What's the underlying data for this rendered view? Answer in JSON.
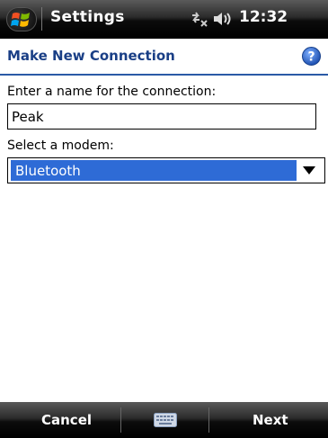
{
  "status_bar": {
    "app_title": "Settings",
    "time": "12:32",
    "icons": [
      "windows-start-icon",
      "connectivity-icon",
      "volume-icon"
    ]
  },
  "header": {
    "title": "Make New Connection",
    "help_icon": "help-icon"
  },
  "form": {
    "name_label": "Enter a name for the connection:",
    "name_value": "Peak",
    "modem_label": "Select a modem:",
    "modem_value": "Bluetooth"
  },
  "menu_bar": {
    "left_softkey": "Cancel",
    "right_softkey": "Next",
    "center_icon": "keyboard-icon"
  },
  "colors": {
    "accent": "#1a3f86",
    "selection": "#2e6bd6",
    "bar_background": "#000000"
  }
}
